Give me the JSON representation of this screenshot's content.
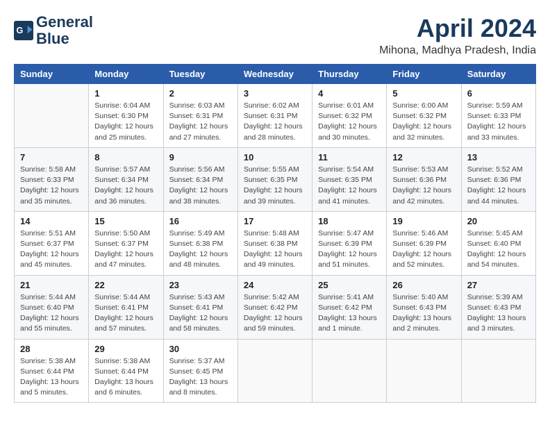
{
  "header": {
    "logo_line1": "General",
    "logo_line2": "Blue",
    "month": "April 2024",
    "location": "Mihona, Madhya Pradesh, India"
  },
  "days_of_week": [
    "Sunday",
    "Monday",
    "Tuesday",
    "Wednesday",
    "Thursday",
    "Friday",
    "Saturday"
  ],
  "weeks": [
    [
      {
        "day": "",
        "info": ""
      },
      {
        "day": "1",
        "info": "Sunrise: 6:04 AM\nSunset: 6:30 PM\nDaylight: 12 hours\nand 25 minutes."
      },
      {
        "day": "2",
        "info": "Sunrise: 6:03 AM\nSunset: 6:31 PM\nDaylight: 12 hours\nand 27 minutes."
      },
      {
        "day": "3",
        "info": "Sunrise: 6:02 AM\nSunset: 6:31 PM\nDaylight: 12 hours\nand 28 minutes."
      },
      {
        "day": "4",
        "info": "Sunrise: 6:01 AM\nSunset: 6:32 PM\nDaylight: 12 hours\nand 30 minutes."
      },
      {
        "day": "5",
        "info": "Sunrise: 6:00 AM\nSunset: 6:32 PM\nDaylight: 12 hours\nand 32 minutes."
      },
      {
        "day": "6",
        "info": "Sunrise: 5:59 AM\nSunset: 6:33 PM\nDaylight: 12 hours\nand 33 minutes."
      }
    ],
    [
      {
        "day": "7",
        "info": "Sunrise: 5:58 AM\nSunset: 6:33 PM\nDaylight: 12 hours\nand 35 minutes."
      },
      {
        "day": "8",
        "info": "Sunrise: 5:57 AM\nSunset: 6:34 PM\nDaylight: 12 hours\nand 36 minutes."
      },
      {
        "day": "9",
        "info": "Sunrise: 5:56 AM\nSunset: 6:34 PM\nDaylight: 12 hours\nand 38 minutes."
      },
      {
        "day": "10",
        "info": "Sunrise: 5:55 AM\nSunset: 6:35 PM\nDaylight: 12 hours\nand 39 minutes."
      },
      {
        "day": "11",
        "info": "Sunrise: 5:54 AM\nSunset: 6:35 PM\nDaylight: 12 hours\nand 41 minutes."
      },
      {
        "day": "12",
        "info": "Sunrise: 5:53 AM\nSunset: 6:36 PM\nDaylight: 12 hours\nand 42 minutes."
      },
      {
        "day": "13",
        "info": "Sunrise: 5:52 AM\nSunset: 6:36 PM\nDaylight: 12 hours\nand 44 minutes."
      }
    ],
    [
      {
        "day": "14",
        "info": "Sunrise: 5:51 AM\nSunset: 6:37 PM\nDaylight: 12 hours\nand 45 minutes."
      },
      {
        "day": "15",
        "info": "Sunrise: 5:50 AM\nSunset: 6:37 PM\nDaylight: 12 hours\nand 47 minutes."
      },
      {
        "day": "16",
        "info": "Sunrise: 5:49 AM\nSunset: 6:38 PM\nDaylight: 12 hours\nand 48 minutes."
      },
      {
        "day": "17",
        "info": "Sunrise: 5:48 AM\nSunset: 6:38 PM\nDaylight: 12 hours\nand 49 minutes."
      },
      {
        "day": "18",
        "info": "Sunrise: 5:47 AM\nSunset: 6:39 PM\nDaylight: 12 hours\nand 51 minutes."
      },
      {
        "day": "19",
        "info": "Sunrise: 5:46 AM\nSunset: 6:39 PM\nDaylight: 12 hours\nand 52 minutes."
      },
      {
        "day": "20",
        "info": "Sunrise: 5:45 AM\nSunset: 6:40 PM\nDaylight: 12 hours\nand 54 minutes."
      }
    ],
    [
      {
        "day": "21",
        "info": "Sunrise: 5:44 AM\nSunset: 6:40 PM\nDaylight: 12 hours\nand 55 minutes."
      },
      {
        "day": "22",
        "info": "Sunrise: 5:44 AM\nSunset: 6:41 PM\nDaylight: 12 hours\nand 57 minutes."
      },
      {
        "day": "23",
        "info": "Sunrise: 5:43 AM\nSunset: 6:41 PM\nDaylight: 12 hours\nand 58 minutes."
      },
      {
        "day": "24",
        "info": "Sunrise: 5:42 AM\nSunset: 6:42 PM\nDaylight: 12 hours\nand 59 minutes."
      },
      {
        "day": "25",
        "info": "Sunrise: 5:41 AM\nSunset: 6:42 PM\nDaylight: 13 hours\nand 1 minute."
      },
      {
        "day": "26",
        "info": "Sunrise: 5:40 AM\nSunset: 6:43 PM\nDaylight: 13 hours\nand 2 minutes."
      },
      {
        "day": "27",
        "info": "Sunrise: 5:39 AM\nSunset: 6:43 PM\nDaylight: 13 hours\nand 3 minutes."
      }
    ],
    [
      {
        "day": "28",
        "info": "Sunrise: 5:38 AM\nSunset: 6:44 PM\nDaylight: 13 hours\nand 5 minutes."
      },
      {
        "day": "29",
        "info": "Sunrise: 5:38 AM\nSunset: 6:44 PM\nDaylight: 13 hours\nand 6 minutes."
      },
      {
        "day": "30",
        "info": "Sunrise: 5:37 AM\nSunset: 6:45 PM\nDaylight: 13 hours\nand 8 minutes."
      },
      {
        "day": "",
        "info": ""
      },
      {
        "day": "",
        "info": ""
      },
      {
        "day": "",
        "info": ""
      },
      {
        "day": "",
        "info": ""
      }
    ]
  ]
}
